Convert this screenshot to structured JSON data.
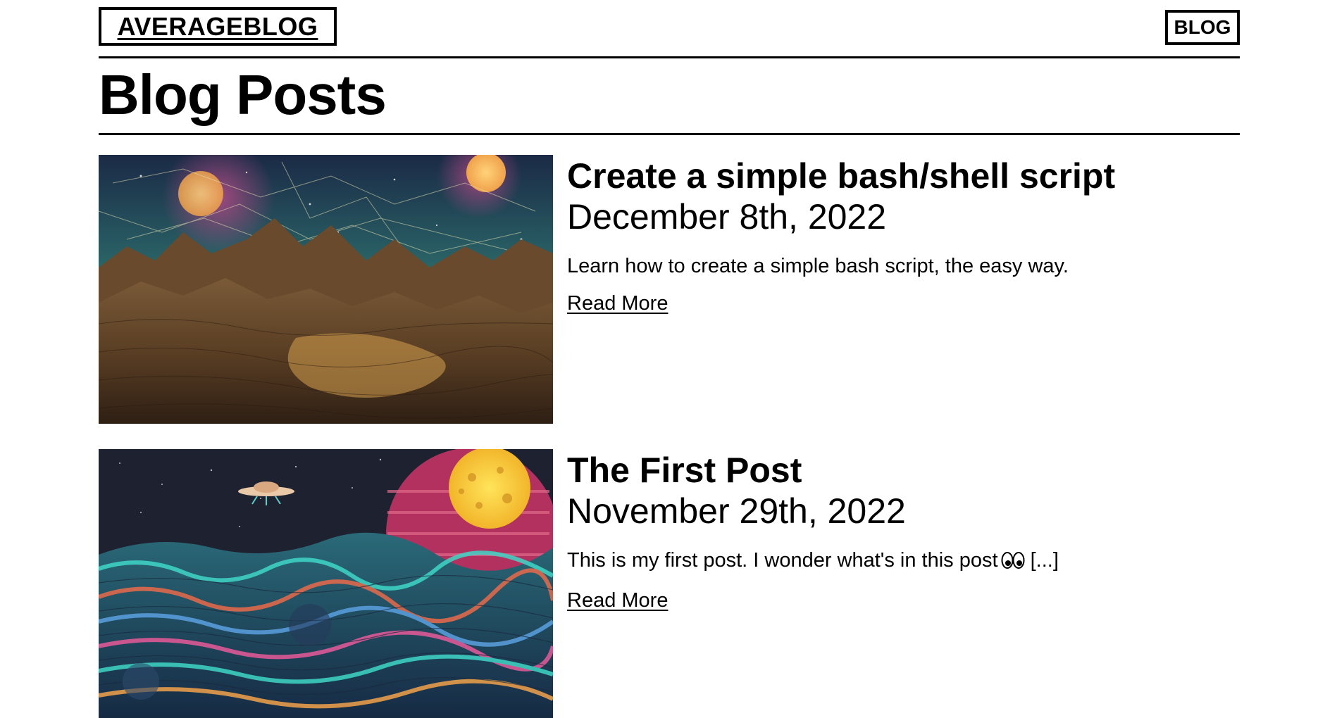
{
  "header": {
    "logo_text": "AVERAGEBLOG",
    "nav_blog_label": "BLOG"
  },
  "page": {
    "title": "Blog Posts"
  },
  "posts": [
    {
      "title": "Create a simple bash/shell script",
      "date": "December 8th, 2022",
      "excerpt": "Learn how to create a simple bash script, the easy way.",
      "read_more": "Read More",
      "image_icon": "desert-mountains-night-sky-illustration"
    },
    {
      "title": "The First Post",
      "date": "November 29th, 2022",
      "excerpt": "This is my first post. I wonder what's in this post",
      "excerpt_suffix": "[...]",
      "excerpt_emoji": "eyes-icon",
      "read_more": "Read More",
      "image_icon": "ocean-waves-planet-ufo-illustration"
    }
  ],
  "colors": {
    "text": "#000000",
    "background": "#ffffff"
  }
}
